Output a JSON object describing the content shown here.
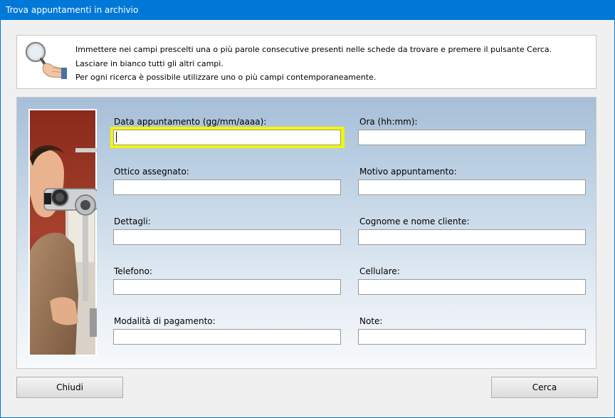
{
  "window": {
    "title": "Trova appuntamenti in archivio"
  },
  "info": {
    "icon": "magnifier-hand-icon",
    "lines": [
      "Immettere nei campi prescelti una o più parole consecutive presenti nelle schede da trovare e premere il pulsante Cerca.",
      "Lasciare in bianco tutti gli altri campi.",
      "Per ogni ricerca è possibile utilizzare uno o più campi contemporaneamente."
    ]
  },
  "form": {
    "fields": [
      {
        "label": "Data appuntamento (gg/mm/aaaa):",
        "value": "",
        "focused": true
      },
      {
        "label": "Ora (hh:mm):",
        "value": ""
      },
      {
        "label": "Ottico assegnato:",
        "value": ""
      },
      {
        "label": "Motivo appuntamento:",
        "value": ""
      },
      {
        "label": "Dettagli:",
        "value": ""
      },
      {
        "label": "Cognome e nome cliente:",
        "value": ""
      },
      {
        "label": "Telefono:",
        "value": ""
      },
      {
        "label": "Cellulare:",
        "value": ""
      },
      {
        "label": "Modalità di pagamento:",
        "value": ""
      },
      {
        "label": "Note:",
        "value": ""
      }
    ],
    "focus_color": "#f5f500"
  },
  "buttons": {
    "close_label": "Chiudi",
    "search_label": "Cerca"
  },
  "colors": {
    "titlebar": "#0078d7",
    "client": "#f0f0f0"
  }
}
